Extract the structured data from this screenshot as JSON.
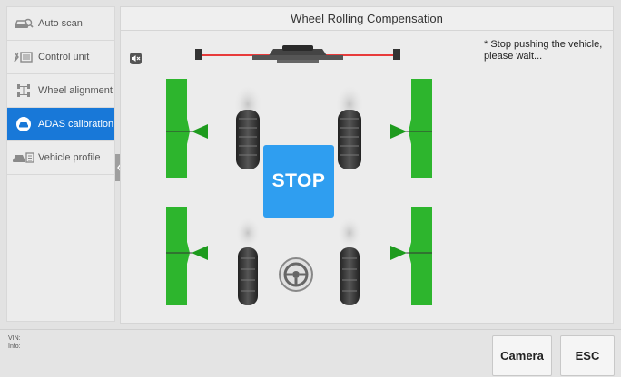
{
  "sidebar": {
    "items": [
      {
        "label": "Auto scan",
        "icon": "car-scan-icon",
        "active": false
      },
      {
        "label": "Control unit",
        "icon": "control-unit-icon",
        "active": false
      },
      {
        "label": "Wheel alignment",
        "icon": "wheel-alignment-icon",
        "active": false
      },
      {
        "label": "ADAS calibration",
        "icon": "adas-icon",
        "active": true
      },
      {
        "label": "Vehicle profile",
        "icon": "vehicle-profile-icon",
        "active": false
      }
    ]
  },
  "main": {
    "title": "Wheel Rolling Compensation",
    "stop_label": "STOP",
    "instructions": "* Stop pushing the vehicle, please wait..."
  },
  "footer": {
    "vin_label": "VIN:",
    "info_label": "Info:",
    "camera_label": "Camera",
    "esc_label": "ESC"
  },
  "colors": {
    "accent": "#1878d8",
    "stop_bg": "#2f9ef0",
    "target_green": "#2db52d",
    "target_bar_red": "#e83b3b"
  }
}
